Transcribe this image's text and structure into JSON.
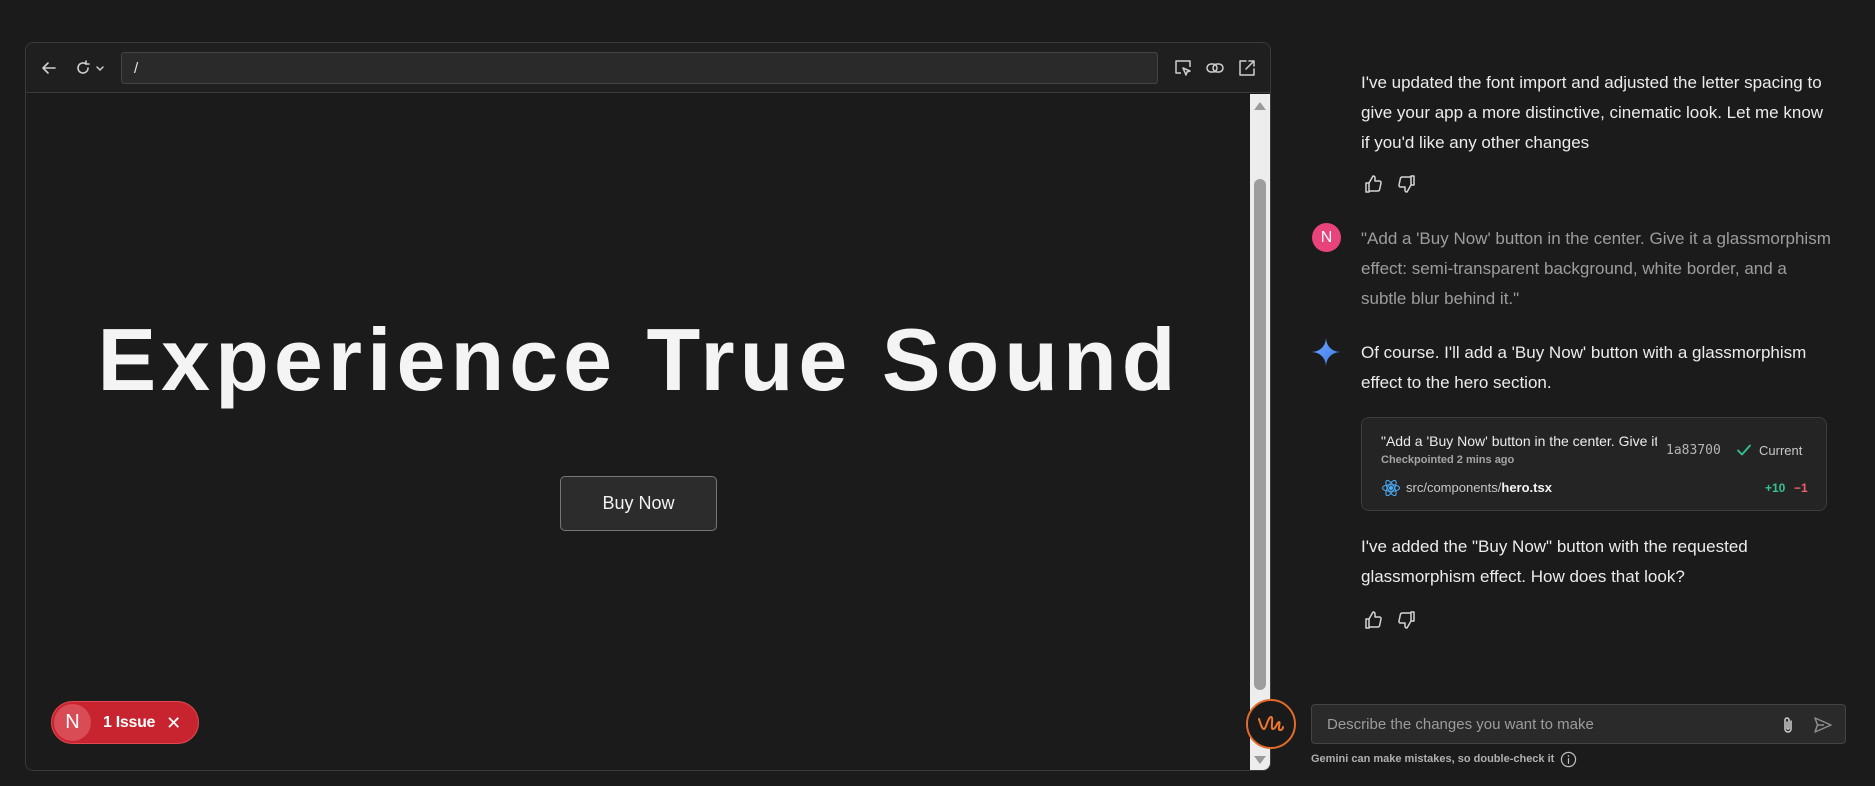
{
  "preview": {
    "url": "/",
    "hero_title": "Experience True Sound",
    "buy_button": "Buy Now",
    "issue_badge": {
      "avatar_letter": "N",
      "label": "1 Issue"
    }
  },
  "chat": {
    "messages": [
      {
        "role": "model",
        "text": "I've updated the font import and adjusted the letter spacing to give your app a more distinctive, cinematic look. Let me know if you'd like any other changes"
      },
      {
        "role": "user",
        "avatar_letter": "N",
        "text": "\"Add a 'Buy Now' button in the center. Give it a glassmorphism effect: semi-transparent background, white border, and a subtle blur behind it.\""
      },
      {
        "role": "model",
        "text": "Of course. I'll add a 'Buy Now' button with a glassmorphism effect to the hero section."
      },
      {
        "role": "model",
        "text": "I've added the \"Buy Now\" button with the requested glassmorphism effect. How does that look?"
      }
    ],
    "checkpoint": {
      "prompt": "\"Add a 'Buy Now' button in the center. Give it a glassmorphism effect",
      "time": "Checkpointed 2 mins ago",
      "hash": "1a83700",
      "status": "Current",
      "path_dir": "src/components/",
      "path_file": "hero.tsx",
      "additions": "+10",
      "deletions": "−1"
    },
    "input_placeholder": "Describe the changes you want to make",
    "disclaimer": "Gemini can make mistakes, so double-check it"
  },
  "colors": {
    "background": "#1b1b1c",
    "accent_green": "#34c38f",
    "accent_red": "#f0616d",
    "issue_red": "#c8242f",
    "user_avatar": "#e8437b",
    "gemini_blue": "#4285f4"
  },
  "icons": [
    "back-arrow-icon",
    "reload-icon",
    "chevron-down-icon",
    "inspect-icon",
    "link-icon",
    "external-link-icon",
    "thumbs-up-icon",
    "thumbs-down-icon",
    "gemini-sparkle-icon",
    "check-icon",
    "react-icon",
    "paperclip-icon",
    "send-icon",
    "info-icon",
    "close-icon"
  ]
}
